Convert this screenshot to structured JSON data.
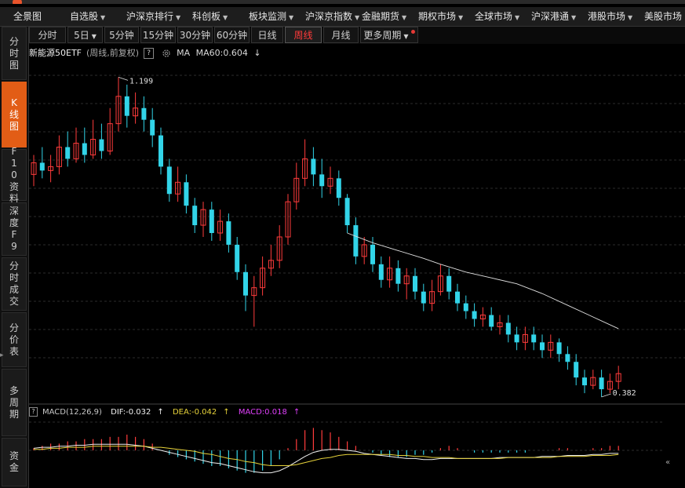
{
  "menu": [
    {
      "label": "全景图",
      "arrow": false
    },
    {
      "label": "自选股",
      "arrow": true
    },
    {
      "label": "沪深京排行",
      "arrow": true
    },
    {
      "label": "科创板",
      "arrow": true
    },
    {
      "label": "板块监测",
      "arrow": true
    },
    {
      "label": "沪深京指数",
      "arrow": true
    },
    {
      "label": "金融期货",
      "arrow": true
    },
    {
      "label": "期权市场",
      "arrow": true
    },
    {
      "label": "全球市场",
      "arrow": true
    },
    {
      "label": "沪深港通",
      "arrow": true
    },
    {
      "label": "港股市场",
      "arrow": true
    },
    {
      "label": "美股市场",
      "arrow": false
    }
  ],
  "sidebar": [
    {
      "label": "分时图",
      "active": false
    },
    {
      "label": "K线图",
      "active": true
    },
    {
      "label": "F10资料",
      "active": false
    },
    {
      "label": "深度F9",
      "active": false
    },
    {
      "label": "分时成交",
      "active": false
    },
    {
      "label": "分价表",
      "active": false
    },
    {
      "label": "多周期",
      "active": false
    },
    {
      "label": "资金",
      "active": false
    }
  ],
  "periods": [
    {
      "label": "分时",
      "active": false
    },
    {
      "label": "5日",
      "active": false,
      "arrow": true
    },
    {
      "label": "5分钟",
      "active": false
    },
    {
      "label": "15分钟",
      "active": false
    },
    {
      "label": "30分钟",
      "active": false
    },
    {
      "label": "60分钟",
      "active": false
    },
    {
      "label": "日线",
      "active": false
    },
    {
      "label": "周线",
      "active": true
    },
    {
      "label": "月线",
      "active": false
    },
    {
      "label": "更多周期",
      "active": false,
      "arrow": true,
      "dot": true
    }
  ],
  "info": {
    "stock_name": "新能源50ETF",
    "qualifier": "(周线,前复权)",
    "help": "?",
    "ma_label": "MA",
    "ma60": "MA60:0.604",
    "ma_arrow": "↓"
  },
  "macd_info": {
    "help": "?",
    "label": "MACD(12,26,9)",
    "dif": "DIF:-0.032",
    "dea": "DEA:-0.042",
    "macd": "MACD:0.018",
    "up_arrow": "↑"
  },
  "scroll_icon": "«",
  "colors": {
    "up": "#ff3b3b",
    "down": "#32d4e8",
    "ma": "#e0e0e0",
    "dif": "#f0f0f0",
    "dea": "#e6d23a",
    "grid": "#3a3a3a"
  },
  "chart_data": {
    "type": "candlestick",
    "price_range": [
      0.36,
      1.24
    ],
    "high_label": "1.199",
    "low_label": "0.382",
    "candles": [
      [
        0.95,
        0.98,
        1.0,
        0.92
      ],
      [
        0.98,
        0.96,
        1.02,
        0.94
      ],
      [
        0.96,
        0.97,
        1.0,
        0.93
      ],
      [
        0.97,
        1.02,
        1.05,
        0.95
      ],
      [
        1.02,
        0.99,
        1.06,
        0.97
      ],
      [
        0.99,
        1.03,
        1.07,
        0.98
      ],
      [
        1.03,
        1.0,
        1.07,
        0.98
      ],
      [
        1.0,
        1.04,
        1.09,
        0.99
      ],
      [
        1.04,
        1.01,
        1.08,
        0.99
      ],
      [
        1.01,
        1.08,
        1.12,
        1.0
      ],
      [
        1.08,
        1.15,
        1.199,
        1.06
      ],
      [
        1.15,
        1.1,
        1.18,
        1.07
      ],
      [
        1.1,
        1.12,
        1.16,
        1.08
      ],
      [
        1.12,
        1.09,
        1.15,
        1.06
      ],
      [
        1.09,
        1.05,
        1.12,
        1.02
      ],
      [
        1.05,
        0.97,
        1.07,
        0.95
      ],
      [
        0.97,
        0.9,
        0.99,
        0.88
      ],
      [
        0.9,
        0.93,
        0.97,
        0.88
      ],
      [
        0.93,
        0.87,
        0.95,
        0.85
      ],
      [
        0.87,
        0.82,
        0.89,
        0.8
      ],
      [
        0.82,
        0.86,
        0.88,
        0.79
      ],
      [
        0.86,
        0.8,
        0.88,
        0.78
      ],
      [
        0.8,
        0.83,
        0.86,
        0.78
      ],
      [
        0.83,
        0.77,
        0.85,
        0.75
      ],
      [
        0.77,
        0.7,
        0.79,
        0.68
      ],
      [
        0.7,
        0.64,
        0.72,
        0.6
      ],
      [
        0.64,
        0.66,
        0.69,
        0.56
      ],
      [
        0.66,
        0.71,
        0.74,
        0.64
      ],
      [
        0.71,
        0.73,
        0.77,
        0.69
      ],
      [
        0.73,
        0.79,
        0.82,
        0.71
      ],
      [
        0.79,
        0.88,
        0.9,
        0.77
      ],
      [
        0.88,
        0.94,
        0.98,
        0.86
      ],
      [
        0.94,
        0.99,
        1.04,
        0.92
      ],
      [
        0.99,
        0.95,
        1.02,
        0.92
      ],
      [
        0.95,
        0.92,
        0.99,
        0.89
      ],
      [
        0.92,
        0.94,
        0.97,
        0.9
      ],
      [
        0.94,
        0.89,
        0.96,
        0.87
      ],
      [
        0.89,
        0.82,
        0.9,
        0.8
      ],
      [
        0.82,
        0.74,
        0.84,
        0.72
      ],
      [
        0.74,
        0.77,
        0.79,
        0.72
      ],
      [
        0.77,
        0.72,
        0.79,
        0.7
      ],
      [
        0.72,
        0.68,
        0.74,
        0.66
      ],
      [
        0.68,
        0.71,
        0.74,
        0.66
      ],
      [
        0.71,
        0.67,
        0.73,
        0.65
      ],
      [
        0.67,
        0.69,
        0.71,
        0.63
      ],
      [
        0.69,
        0.65,
        0.71,
        0.63
      ],
      [
        0.65,
        0.62,
        0.67,
        0.6
      ],
      [
        0.62,
        0.65,
        0.68,
        0.6
      ],
      [
        0.65,
        0.69,
        0.72,
        0.64
      ],
      [
        0.69,
        0.65,
        0.71,
        0.63
      ],
      [
        0.65,
        0.62,
        0.67,
        0.6
      ],
      [
        0.62,
        0.6,
        0.64,
        0.58
      ],
      [
        0.6,
        0.58,
        0.62,
        0.56
      ],
      [
        0.58,
        0.59,
        0.61,
        0.56
      ],
      [
        0.59,
        0.56,
        0.61,
        0.55
      ],
      [
        0.56,
        0.57,
        0.59,
        0.54
      ],
      [
        0.57,
        0.54,
        0.59,
        0.52
      ],
      [
        0.54,
        0.52,
        0.56,
        0.5
      ],
      [
        0.52,
        0.54,
        0.56,
        0.5
      ],
      [
        0.54,
        0.52,
        0.56,
        0.5
      ],
      [
        0.52,
        0.5,
        0.54,
        0.48
      ],
      [
        0.5,
        0.52,
        0.54,
        0.48
      ],
      [
        0.52,
        0.49,
        0.53,
        0.47
      ],
      [
        0.49,
        0.47,
        0.51,
        0.45
      ],
      [
        0.47,
        0.43,
        0.49,
        0.41
      ],
      [
        0.43,
        0.41,
        0.45,
        0.39
      ],
      [
        0.41,
        0.43,
        0.45,
        0.4
      ],
      [
        0.43,
        0.4,
        0.45,
        0.38
      ],
      [
        0.4,
        0.42,
        0.44,
        0.39
      ],
      [
        0.42,
        0.44,
        0.46,
        0.4
      ]
    ],
    "ma60": [
      [
        37,
        0.8
      ],
      [
        40,
        0.775
      ],
      [
        43,
        0.755
      ],
      [
        46,
        0.735
      ],
      [
        48,
        0.72
      ],
      [
        51,
        0.7
      ],
      [
        54,
        0.685
      ],
      [
        57,
        0.67
      ],
      [
        60,
        0.645
      ],
      [
        63,
        0.615
      ],
      [
        66,
        0.585
      ],
      [
        69,
        0.555
      ]
    ],
    "macd_hist": [
      0.01,
      0.02,
      0.03,
      0.03,
      0.04,
      0.04,
      0.05,
      0.05,
      0.05,
      0.06,
      0.06,
      0.07,
      0.06,
      0.05,
      0.03,
      0.0,
      -0.02,
      -0.03,
      -0.04,
      -0.05,
      -0.06,
      -0.07,
      -0.07,
      -0.08,
      -0.09,
      -0.1,
      -0.1,
      -0.09,
      -0.07,
      -0.04,
      0.01,
      0.05,
      0.09,
      0.1,
      0.09,
      0.08,
      0.06,
      0.04,
      0.02,
      0.0,
      -0.01,
      -0.02,
      -0.03,
      -0.03,
      -0.03,
      -0.02,
      -0.02,
      -0.01,
      0.01,
      0.02,
      0.01,
      0.0,
      -0.01,
      -0.01,
      -0.01,
      -0.01,
      -0.01,
      -0.01,
      -0.01,
      0.0,
      0.0,
      0.0,
      0.01,
      0.01,
      0.0,
      0.0,
      0.01,
      0.01,
      0.02,
      0.02
    ],
    "dif": [
      0.02,
      0.03,
      0.03,
      0.04,
      0.04,
      0.05,
      0.05,
      0.06,
      0.06,
      0.06,
      0.06,
      0.06,
      0.05,
      0.04,
      0.02,
      0.0,
      -0.02,
      -0.04,
      -0.06,
      -0.08,
      -0.1,
      -0.12,
      -0.13,
      -0.15,
      -0.17,
      -0.19,
      -0.21,
      -0.22,
      -0.22,
      -0.2,
      -0.16,
      -0.11,
      -0.06,
      -0.02,
      0.0,
      0.01,
      0.01,
      0.0,
      -0.01,
      -0.03,
      -0.04,
      -0.05,
      -0.06,
      -0.07,
      -0.08,
      -0.08,
      -0.09,
      -0.09,
      -0.08,
      -0.08,
      -0.08,
      -0.08,
      -0.08,
      -0.08,
      -0.08,
      -0.07,
      -0.07,
      -0.07,
      -0.07,
      -0.07,
      -0.06,
      -0.06,
      -0.06,
      -0.05,
      -0.05,
      -0.05,
      -0.04,
      -0.04,
      -0.03,
      -0.03
    ],
    "dea": [
      0.01,
      0.01,
      0.02,
      0.02,
      0.03,
      0.03,
      0.03,
      0.04,
      0.04,
      0.04,
      0.04,
      0.04,
      0.04,
      0.04,
      0.03,
      0.03,
      0.02,
      0.01,
      0.0,
      -0.01,
      -0.03,
      -0.04,
      -0.06,
      -0.08,
      -0.09,
      -0.11,
      -0.12,
      -0.14,
      -0.15,
      -0.15,
      -0.15,
      -0.14,
      -0.12,
      -0.1,
      -0.08,
      -0.07,
      -0.05,
      -0.04,
      -0.04,
      -0.04,
      -0.04,
      -0.04,
      -0.04,
      -0.05,
      -0.05,
      -0.06,
      -0.06,
      -0.07,
      -0.07,
      -0.07,
      -0.08,
      -0.08,
      -0.08,
      -0.08,
      -0.08,
      -0.08,
      -0.07,
      -0.07,
      -0.07,
      -0.07,
      -0.07,
      -0.07,
      -0.06,
      -0.06,
      -0.06,
      -0.06,
      -0.05,
      -0.05,
      -0.05,
      -0.04
    ]
  }
}
